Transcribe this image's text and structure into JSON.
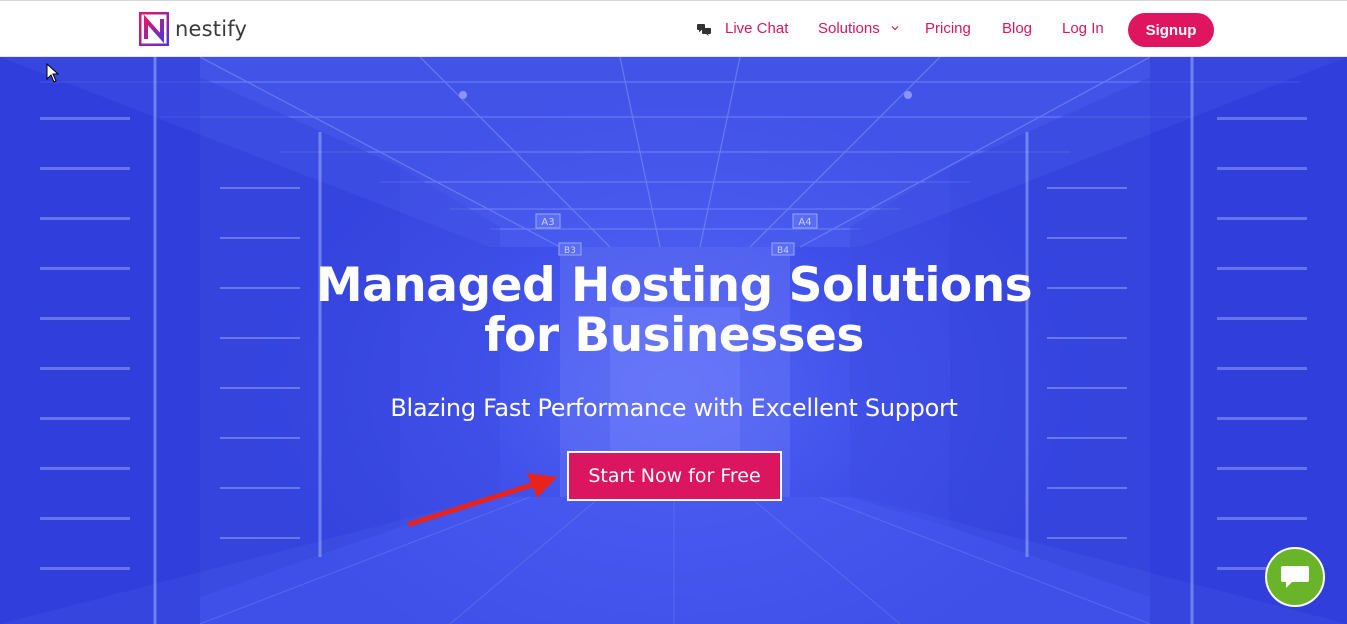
{
  "brand": {
    "name": "nestify"
  },
  "nav": {
    "live_chat": "Live Chat",
    "solutions": "Solutions",
    "pricing": "Pricing",
    "blog": "Blog",
    "login": "Log In",
    "signup": "Signup"
  },
  "hero": {
    "title": "Managed Hosting Solutions for Businesses",
    "subtitle": "Blazing Fast Performance with Excellent Support",
    "cta": "Start Now for Free",
    "signs": [
      "A3",
      "A4",
      "B3",
      "B4"
    ]
  },
  "icons": {
    "chat_nav": "chat-bubbles-icon",
    "dropdown": "chevron-down-icon",
    "chat_widget": "chat-bubble-icon",
    "arrow": "red-arrow-annotation",
    "cursor": "mouse-pointer-icon"
  },
  "colors": {
    "accent": "#e0155f",
    "hero_blue": "#4253ec",
    "chat_green": "#6ab42a",
    "text_dark": "#3a3a3a"
  }
}
